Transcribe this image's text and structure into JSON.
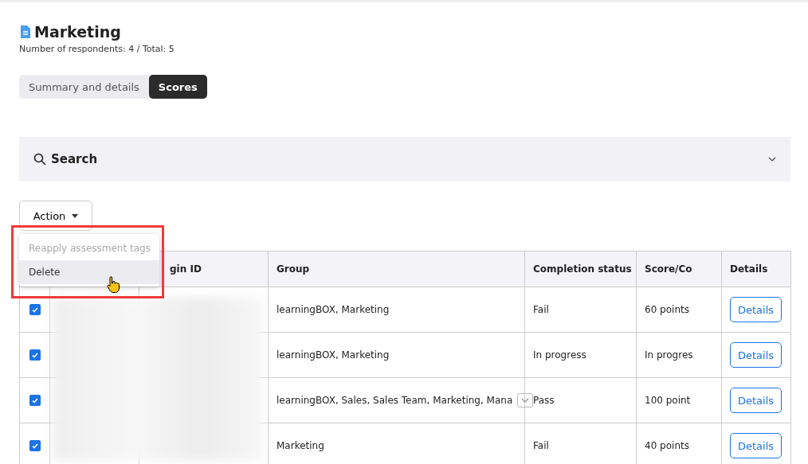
{
  "title": "Marketing",
  "subtitle": "Number of respondents: 4 / Total: 5",
  "tabs": [
    {
      "label": "Summary and details",
      "selected": false
    },
    {
      "label": "Scores",
      "selected": true
    }
  ],
  "search": {
    "label": "Search",
    "expanded": false
  },
  "action": {
    "label": "Action",
    "menu": [
      {
        "label": "Reapply assessment tags",
        "disabled": true,
        "hovered": false
      },
      {
        "label": "Delete",
        "disabled": false,
        "hovered": true
      }
    ]
  },
  "table": {
    "columns": [
      "gin ID",
      "Group",
      "Completion status",
      "Score/Co",
      "Details"
    ],
    "rows": [
      {
        "checked": true,
        "group": "learningBOX, Marketing",
        "group_more": false,
        "status": "Fail",
        "score": "60 points",
        "details": "Details"
      },
      {
        "checked": true,
        "group": "learningBOX, Marketing",
        "group_more": false,
        "status": "In progress",
        "score": "In progres",
        "details": "Details"
      },
      {
        "checked": true,
        "group": "learningBOX, Sales, Sales Team, Marketing, Mana",
        "group_more": true,
        "status": "Pass",
        "score": "100 point",
        "details": "Details"
      },
      {
        "checked": true,
        "group": "Marketing",
        "group_more": false,
        "status": "Fail",
        "score": "40 points",
        "details": "Details"
      }
    ]
  }
}
